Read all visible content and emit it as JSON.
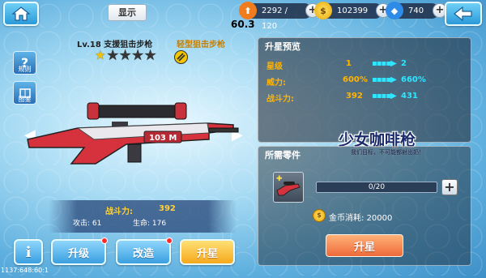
{
  "top": {
    "show_label": "显示",
    "stamina": "2292 / 120",
    "coins": "102399",
    "diamonds": "740",
    "fps": "60.3"
  },
  "weapon": {
    "level_name": "Lv.18  支援狙击步枪",
    "type": "轻型狙击步枪",
    "stars": 1,
    "max_stars": 5,
    "combat_power_label": "战斗力:",
    "combat_power": "392",
    "attack": "攻击: 61",
    "life": "生命: 176",
    "gun_text": "103 M"
  },
  "side": {
    "rules_label": "规则",
    "guide_label": "图鉴"
  },
  "buttons": {
    "info": "i",
    "upgrade": "升级",
    "modify": "改造",
    "star_up": "升星"
  },
  "coords_text": "1137:648:60:1",
  "preview": {
    "title": "升星预览",
    "rows": [
      {
        "label": "星级",
        "from": "1",
        "to": "2"
      },
      {
        "label": "威力:",
        "from": "600%",
        "to": "660%"
      },
      {
        "label": "战斗力:",
        "from": "392",
        "to": "431"
      }
    ]
  },
  "logo": {
    "title": "少女咖啡枪",
    "subtitle": "我们目标，不可能都射出奶！"
  },
  "parts": {
    "title": "所需零件",
    "progress": "0/20",
    "progress_fraction": 0,
    "cost_label": "金币消耗:",
    "cost": "20000",
    "star_up_button": "升星"
  },
  "colors": {
    "accent_yellow": "#ffb400",
    "accent_cyan": "#2fe6ff",
    "star_up_orange": "#ee6a3a"
  }
}
